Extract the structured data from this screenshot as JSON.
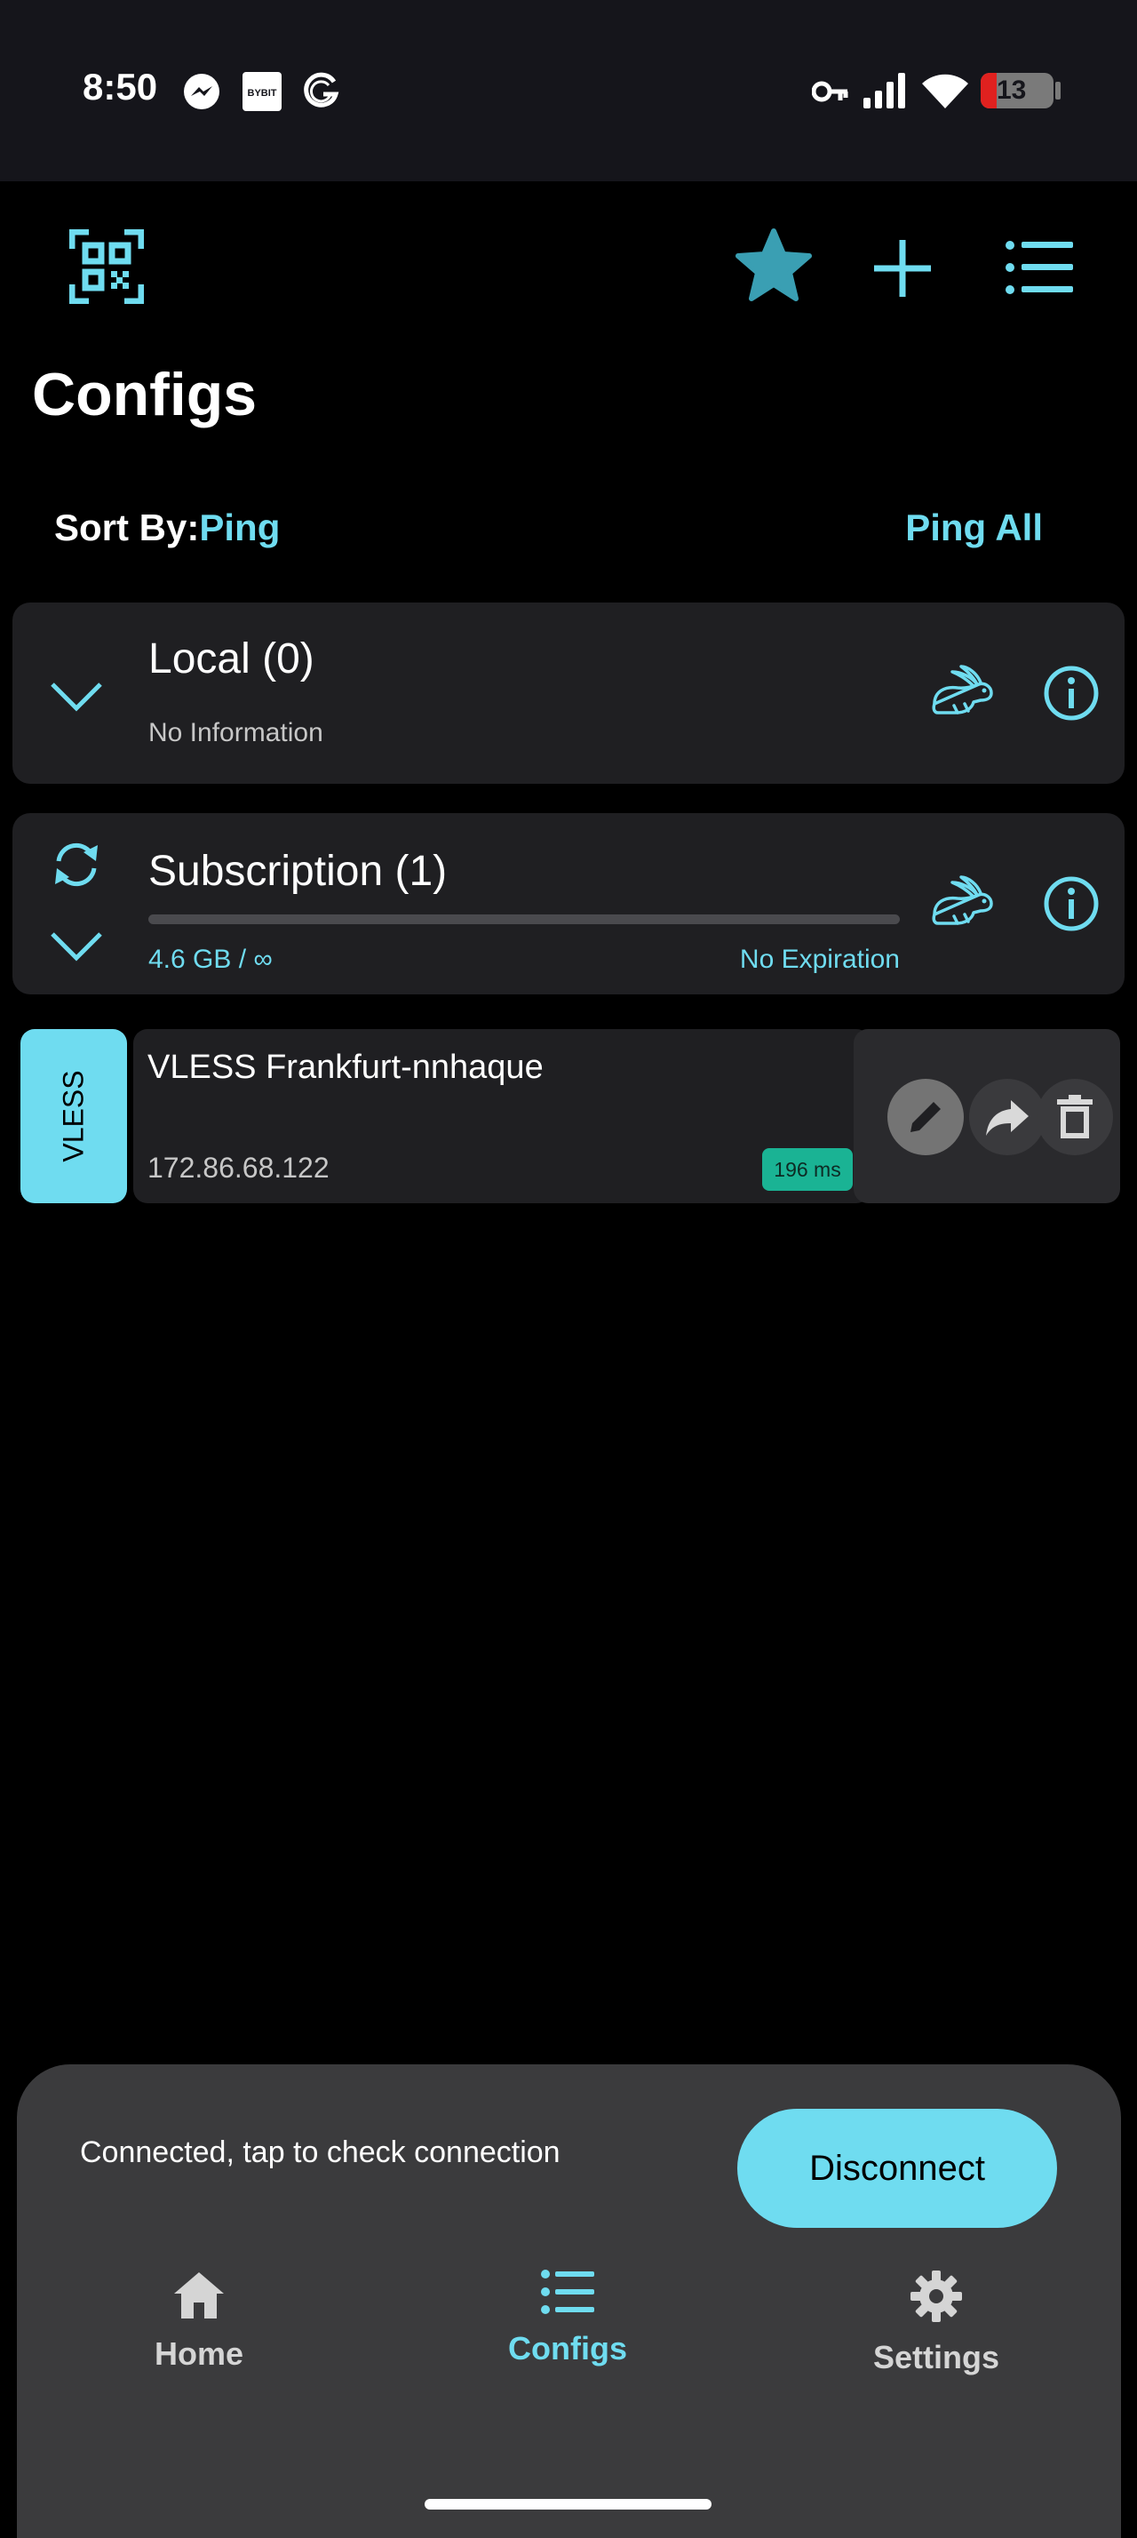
{
  "status_bar": {
    "time": "8:50",
    "notification_icons": [
      "messenger-icon",
      "bybit-icon",
      "grammarly-icon"
    ],
    "system_icons": [
      "vpn-key-icon",
      "signal-icon",
      "wifi-icon",
      "battery-icon"
    ],
    "bybit_label": "BYBIT",
    "battery_level": "13"
  },
  "app_bar": {
    "icons": [
      "qr-scan-icon",
      "star-icon",
      "add-icon",
      "list-icon"
    ]
  },
  "page": {
    "title": "Configs"
  },
  "sort": {
    "label": "Sort By:",
    "value": "Ping",
    "ping_all": "Ping All"
  },
  "groups": [
    {
      "title": "Local (0)",
      "subtitle": "No Information"
    },
    {
      "title": "Subscription (1)",
      "usage": "4.6 GB / ∞",
      "expiration": "No Expiration"
    }
  ],
  "configs": [
    {
      "protocol": "VLESS",
      "name": "VLESS Frankfurt-nnhaque",
      "address": "172.86.68.122",
      "ping": "196 ms"
    }
  ],
  "connection": {
    "status_text": "Connected, tap to check connection",
    "button_label": "Disconnect"
  },
  "bottom_nav": {
    "items": [
      {
        "label": "Home",
        "icon": "home-icon",
        "active": false
      },
      {
        "label": "Configs",
        "icon": "list-icon",
        "active": true
      },
      {
        "label": "Settings",
        "icon": "gear-icon",
        "active": false
      }
    ]
  },
  "colors": {
    "accent": "#6fdcf0",
    "background": "#000000",
    "card": "#1f1f22",
    "ping_badge": "#1ab394",
    "sheet": "#3b3b3d"
  }
}
